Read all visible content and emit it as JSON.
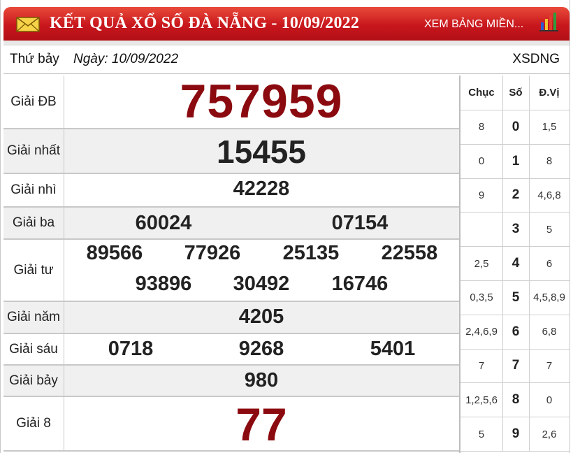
{
  "header": {
    "title": "KẾT QUẢ XỔ SỐ ĐÀ NẴNG - 10/09/2022",
    "region_link": "XEM BẢNG MIỀN...",
    "icons": [
      "mail-icon",
      "bar-chart-icon"
    ],
    "colors": {
      "header_bg": "#c8161d",
      "number_red": "#8b0a0f"
    }
  },
  "subheader": {
    "day": "Thứ bảy",
    "date": "Ngày: 10/09/2022",
    "code": "XSDNG"
  },
  "prizes": {
    "db": {
      "label": "Giải ĐB",
      "numbers": [
        "757959"
      ]
    },
    "nhat": {
      "label": "Giải nhất",
      "numbers": [
        "15455"
      ]
    },
    "nhi": {
      "label": "Giải nhì",
      "numbers": [
        "42228"
      ]
    },
    "ba": {
      "label": "Giải ba",
      "numbers": [
        "60024",
        "07154"
      ]
    },
    "tu": {
      "label": "Giải tư",
      "numbers": [
        "89566",
        "77926",
        "25135",
        "22558",
        "93896",
        "30492",
        "16746"
      ]
    },
    "nam": {
      "label": "Giải năm",
      "numbers": [
        "4205"
      ]
    },
    "sau": {
      "label": "Giải sáu",
      "numbers": [
        "0718",
        "9268",
        "5401"
      ]
    },
    "bay": {
      "label": "Giải bảy",
      "numbers": [
        "980"
      ]
    },
    "tam": {
      "label": "Giải 8",
      "numbers": [
        "77"
      ]
    }
  },
  "loto": {
    "headers": [
      "Chục",
      "Số",
      "Đ.Vị"
    ],
    "rows": [
      {
        "chuc": "8",
        "so": "0",
        "dvi": "1,5"
      },
      {
        "chuc": "0",
        "so": "1",
        "dvi": "8"
      },
      {
        "chuc": "9",
        "so": "2",
        "dvi": "4,6,8"
      },
      {
        "chuc": "",
        "so": "3",
        "dvi": "5"
      },
      {
        "chuc": "2,5",
        "so": "4",
        "dvi": "6"
      },
      {
        "chuc": "0,3,5",
        "so": "5",
        "dvi": "4,5,8,9"
      },
      {
        "chuc": "2,4,6,9",
        "so": "6",
        "dvi": "6,8"
      },
      {
        "chuc": "7",
        "so": "7",
        "dvi": "7"
      },
      {
        "chuc": "1,2,5,6",
        "so": "8",
        "dvi": "0"
      },
      {
        "chuc": "5",
        "so": "9",
        "dvi": "2,6"
      }
    ]
  }
}
